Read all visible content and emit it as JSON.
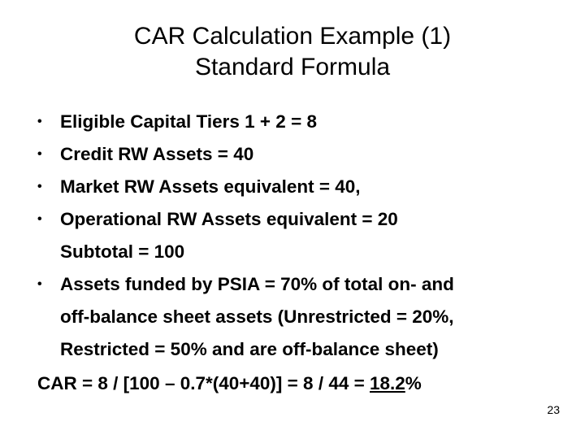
{
  "slide": {
    "title": {
      "line1": "CAR Calculation Example (1)",
      "line2": "Standard Formula"
    },
    "bullets": [
      {
        "text": "Eligible Capital Tiers 1 + 2 = 8",
        "marker": true
      },
      {
        "text": "Credit RW Assets = 40",
        "marker": true
      },
      {
        "text": "Market RW Assets equivalent = 40,",
        "marker": true
      },
      {
        "text": "Operational RW Assets equivalent = 20",
        "marker": true
      },
      {
        "text": "Subtotal = 100",
        "marker": false
      },
      {
        "text": "Assets funded by PSIA = 70% of total on- and",
        "marker": true,
        "cont1": "off-balance sheet assets (Unrestricted = 20%,",
        "cont2": "Restricted = 50% and are off-balance sheet)"
      }
    ],
    "final_line": {
      "prefix": "CAR = 8 / [100 – 0.7*(40+40)] = 8 / 44 = ",
      "highlight": "18.2",
      "suffix": "%"
    },
    "page_number": "23"
  }
}
